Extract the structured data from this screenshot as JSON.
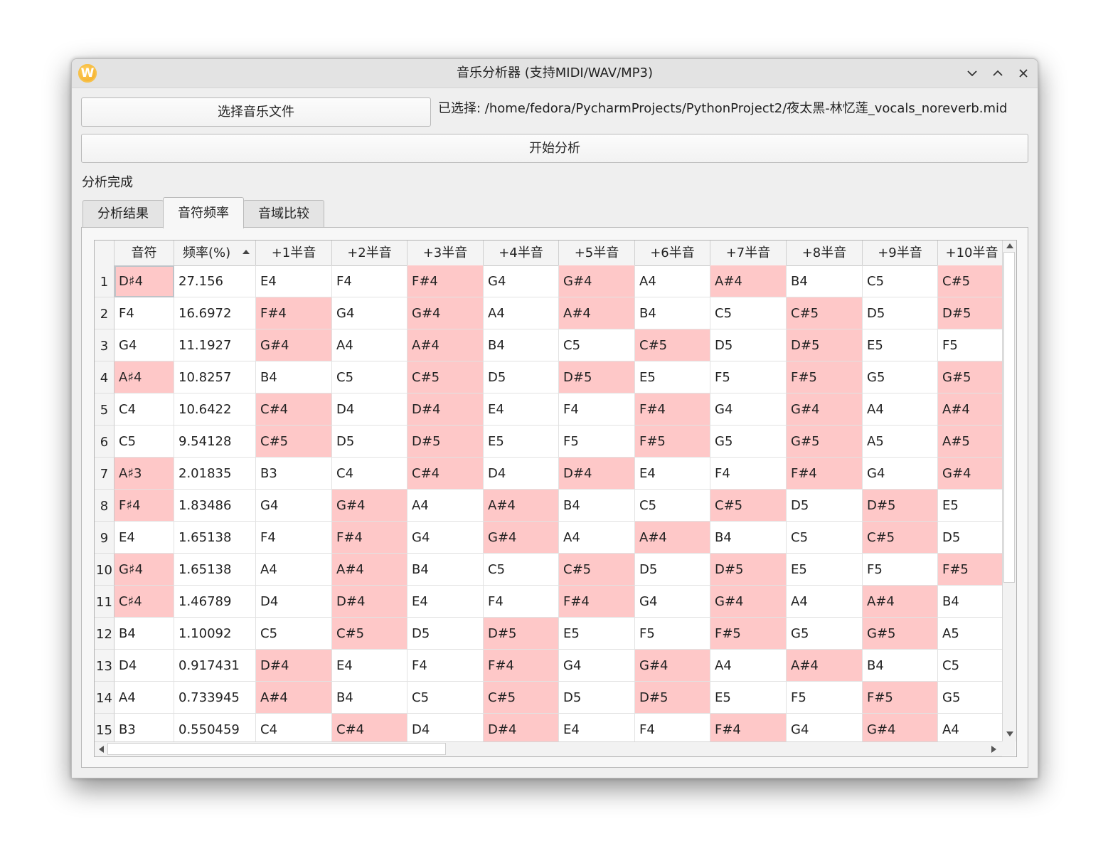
{
  "window": {
    "title": "音乐分析器 (支持MIDI/WAV/MP3)",
    "app_icon": "W"
  },
  "controls": {
    "select_file_label": "选择音乐文件",
    "selected_path": "已选择: /home/fedora/PycharmProjects/PythonProject2/夜太黑-林忆莲_vocals_noreverb.mid",
    "start_label": "开始分析",
    "status": "分析完成"
  },
  "tabs": [
    "分析结果",
    "音符频率",
    "音域比较"
  ],
  "table": {
    "headers": [
      "音符",
      "频率(%)",
      "+1半音",
      "+2半音",
      "+3半音",
      "+4半音",
      "+5半音",
      "+6半音",
      "+7半音",
      "+8半音",
      "+9半音",
      "+10半音"
    ],
    "sorted_column": "频率(%)",
    "highlight_color": "#fec8c8",
    "rows": [
      {
        "num": "1",
        "cells": [
          "D♯4",
          "27.156",
          "E4",
          "F4",
          "F#4",
          "G4",
          "G#4",
          "A4",
          "A#4",
          "B4",
          "C5",
          "C#5"
        ]
      },
      {
        "num": "2",
        "cells": [
          "F4",
          "16.6972",
          "F#4",
          "G4",
          "G#4",
          "A4",
          "A#4",
          "B4",
          "C5",
          "C#5",
          "D5",
          "D#5"
        ]
      },
      {
        "num": "3",
        "cells": [
          "G4",
          "11.1927",
          "G#4",
          "A4",
          "A#4",
          "B4",
          "C5",
          "C#5",
          "D5",
          "D#5",
          "E5",
          "F5"
        ]
      },
      {
        "num": "4",
        "cells": [
          "A♯4",
          "10.8257",
          "B4",
          "C5",
          "C#5",
          "D5",
          "D#5",
          "E5",
          "F5",
          "F#5",
          "G5",
          "G#5"
        ]
      },
      {
        "num": "5",
        "cells": [
          "C4",
          "10.6422",
          "C#4",
          "D4",
          "D#4",
          "E4",
          "F4",
          "F#4",
          "G4",
          "G#4",
          "A4",
          "A#4"
        ]
      },
      {
        "num": "6",
        "cells": [
          "C5",
          "9.54128",
          "C#5",
          "D5",
          "D#5",
          "E5",
          "F5",
          "F#5",
          "G5",
          "G#5",
          "A5",
          "A#5"
        ]
      },
      {
        "num": "7",
        "cells": [
          "A♯3",
          "2.01835",
          "B3",
          "C4",
          "C#4",
          "D4",
          "D#4",
          "E4",
          "F4",
          "F#4",
          "G4",
          "G#4"
        ]
      },
      {
        "num": "8",
        "cells": [
          "F♯4",
          "1.83486",
          "G4",
          "G#4",
          "A4",
          "A#4",
          "B4",
          "C5",
          "C#5",
          "D5",
          "D#5",
          "E5"
        ]
      },
      {
        "num": "9",
        "cells": [
          "E4",
          "1.65138",
          "F4",
          "F#4",
          "G4",
          "G#4",
          "A4",
          "A#4",
          "B4",
          "C5",
          "C#5",
          "D5"
        ]
      },
      {
        "num": "10",
        "cells": [
          "G♯4",
          "1.65138",
          "A4",
          "A#4",
          "B4",
          "C5",
          "C#5",
          "D5",
          "D#5",
          "E5",
          "F5",
          "F#5"
        ]
      },
      {
        "num": "11",
        "cells": [
          "C♯4",
          "1.46789",
          "D4",
          "D#4",
          "E4",
          "F4",
          "F#4",
          "G4",
          "G#4",
          "A4",
          "A#4",
          "B4"
        ]
      },
      {
        "num": "12",
        "cells": [
          "B4",
          "1.10092",
          "C5",
          "C#5",
          "D5",
          "D#5",
          "E5",
          "F5",
          "F#5",
          "G5",
          "G#5",
          "A5"
        ]
      },
      {
        "num": "13",
        "cells": [
          "D4",
          "0.917431",
          "D#4",
          "E4",
          "F4",
          "F#4",
          "G4",
          "G#4",
          "A4",
          "A#4",
          "B4",
          "C5"
        ]
      },
      {
        "num": "14",
        "cells": [
          "A4",
          "0.733945",
          "A#4",
          "B4",
          "C5",
          "C#5",
          "D5",
          "D#5",
          "E5",
          "F5",
          "F#5",
          "G5"
        ]
      },
      {
        "num": "15",
        "cells": [
          "B3",
          "0.550459",
          "C4",
          "C#4",
          "D4",
          "D#4",
          "E4",
          "F4",
          "F#4",
          "G4",
          "G#4",
          "A4"
        ]
      }
    ]
  }
}
